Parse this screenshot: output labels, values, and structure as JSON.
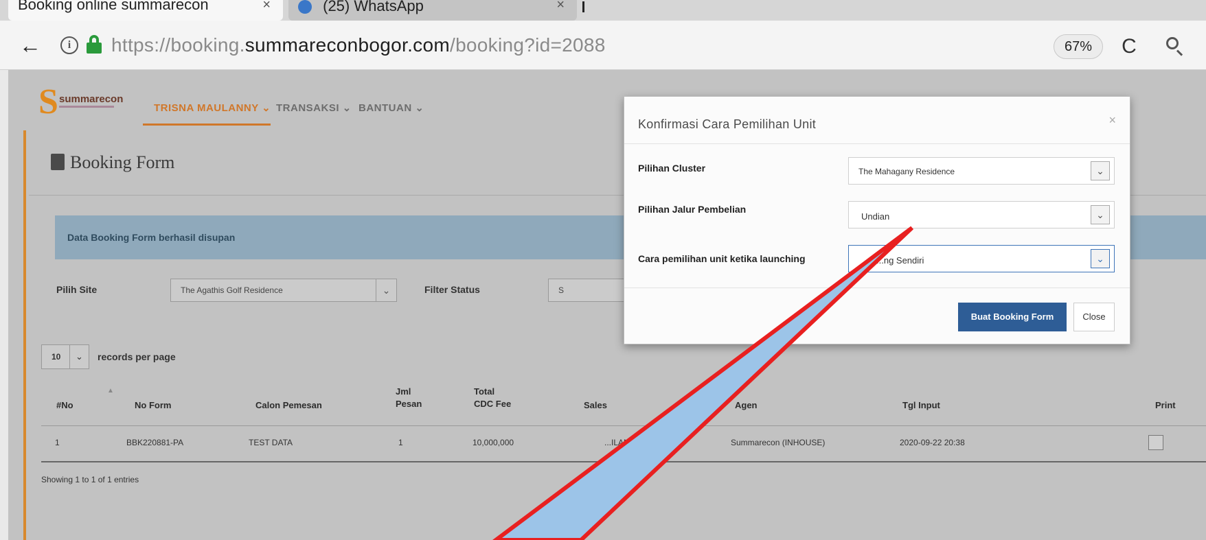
{
  "browser": {
    "tabs": [
      {
        "title": "Booking online summarecon",
        "close": "×"
      },
      {
        "title": "(25) WhatsApp",
        "close": "×"
      }
    ],
    "back_icon": "←",
    "url_prefix": "https://booking.",
    "url_domain": "summareconbogor.com",
    "url_path": "/booking?id=2088",
    "zoom": "67%",
    "reload_icon": "C"
  },
  "app": {
    "logo_text": "summarecon",
    "nav": [
      {
        "label": "TRISNA MAULANNY ⌄"
      },
      {
        "label": "TRANSAKSI ⌄"
      },
      {
        "label": "BANTUAN ⌄"
      }
    ]
  },
  "page": {
    "title": "Booking Form",
    "alert": "Data Booking Form berhasil disupan",
    "filters": {
      "site_label": "Pilih Site",
      "site_value": "The Agathis Golf Residence",
      "status_label": "Filter Status",
      "status_value": "S"
    },
    "per_page_value": "10",
    "per_page_label": "records per page",
    "table": {
      "headers": [
        "#No",
        "No Form",
        "Calon Pemesan",
        "Jml\nPesan",
        "Total\nCDC Fee",
        "Sales",
        "Agen",
        "Tgl Input",
        "Print"
      ],
      "rows": [
        [
          "1",
          "BBK220881-PA",
          "TEST DATA",
          "1",
          "10,000,000",
          "...ILANNY",
          "Summarecon (INHOUSE)",
          "2020-09-22 20:38",
          ""
        ]
      ]
    },
    "showing": "Showing 1 to 1 of 1 entries"
  },
  "modal": {
    "title": "Konfirmasi Cara Pemilihan Unit",
    "close_x": "×",
    "fields": [
      {
        "label": "Pilihan Cluster",
        "value": "The Mahagany Residence"
      },
      {
        "label": "Pilihan Jalur Pembelian",
        "value": "Undian"
      },
      {
        "label": "Cara pemilihan unit ketika launching",
        "value": "...ng Sendiri"
      }
    ],
    "submit_label": "Buat Booking Form",
    "close_label": "Close"
  },
  "colors": {
    "accent": "#d0772a",
    "primary_button": "#2e5d96",
    "annotation_stroke": "#e82020",
    "annotation_fill": "#9cc4e8"
  }
}
